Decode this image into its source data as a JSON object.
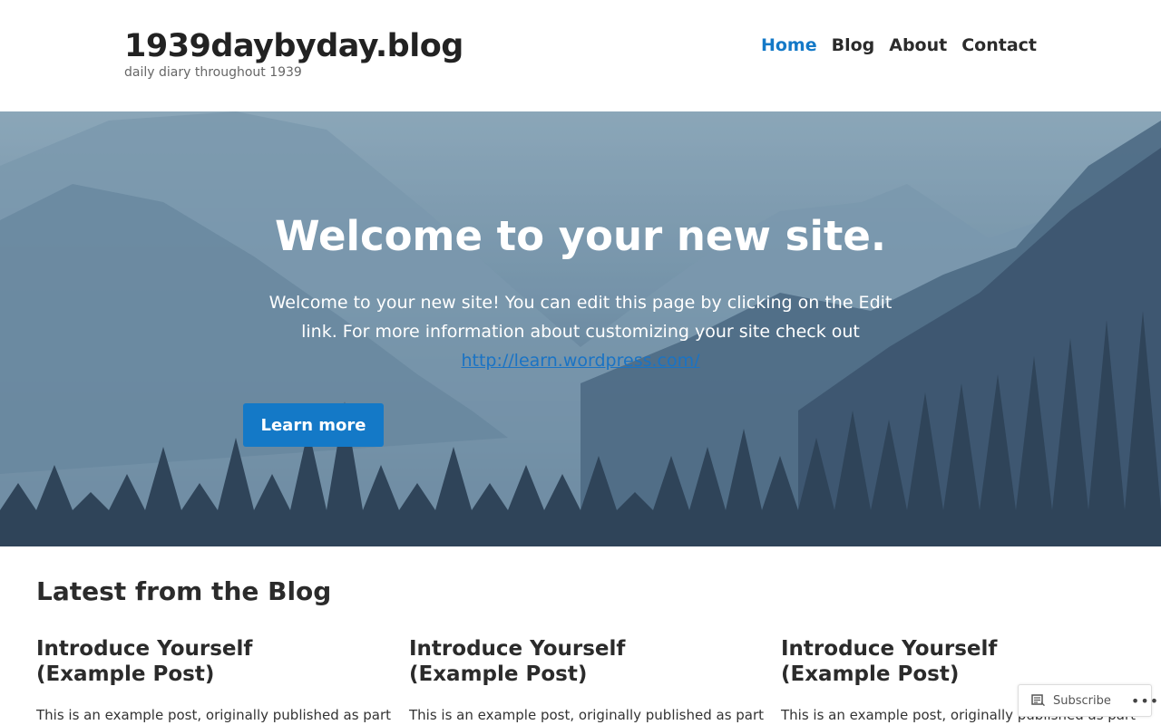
{
  "header": {
    "site_title": "1939daybyday.blog",
    "tagline": "daily diary throughout 1939",
    "nav": [
      {
        "label": "Home",
        "active": true
      },
      {
        "label": "Blog",
        "active": false
      },
      {
        "label": "About",
        "active": false
      },
      {
        "label": "Contact",
        "active": false
      }
    ]
  },
  "hero": {
    "title": "Welcome to your new site.",
    "text_before_link": "Welcome to your new site! You can edit this page by clicking on the Edit link. For more information about customizing your site check out ",
    "link_text": "http://learn.wordpress.com/",
    "button_label": "Learn more"
  },
  "blog": {
    "heading": "Latest from the Blog",
    "posts": [
      {
        "title": "Introduce Yourself\n(Example Post)",
        "excerpt": "This is an example post, originally published as part"
      },
      {
        "title": "Introduce Yourself\n(Example Post)",
        "excerpt": "This is an example post, originally published as part"
      },
      {
        "title": "Introduce Yourself\n(Example Post)",
        "excerpt": "This is an example post, originally published as part"
      }
    ]
  },
  "widget": {
    "subscribe_label": "Subscribe",
    "more_label": "•••",
    "subscribe_icon": "reader-icon"
  },
  "colors": {
    "accent": "#1479c7",
    "text": "#2b2b2b"
  }
}
